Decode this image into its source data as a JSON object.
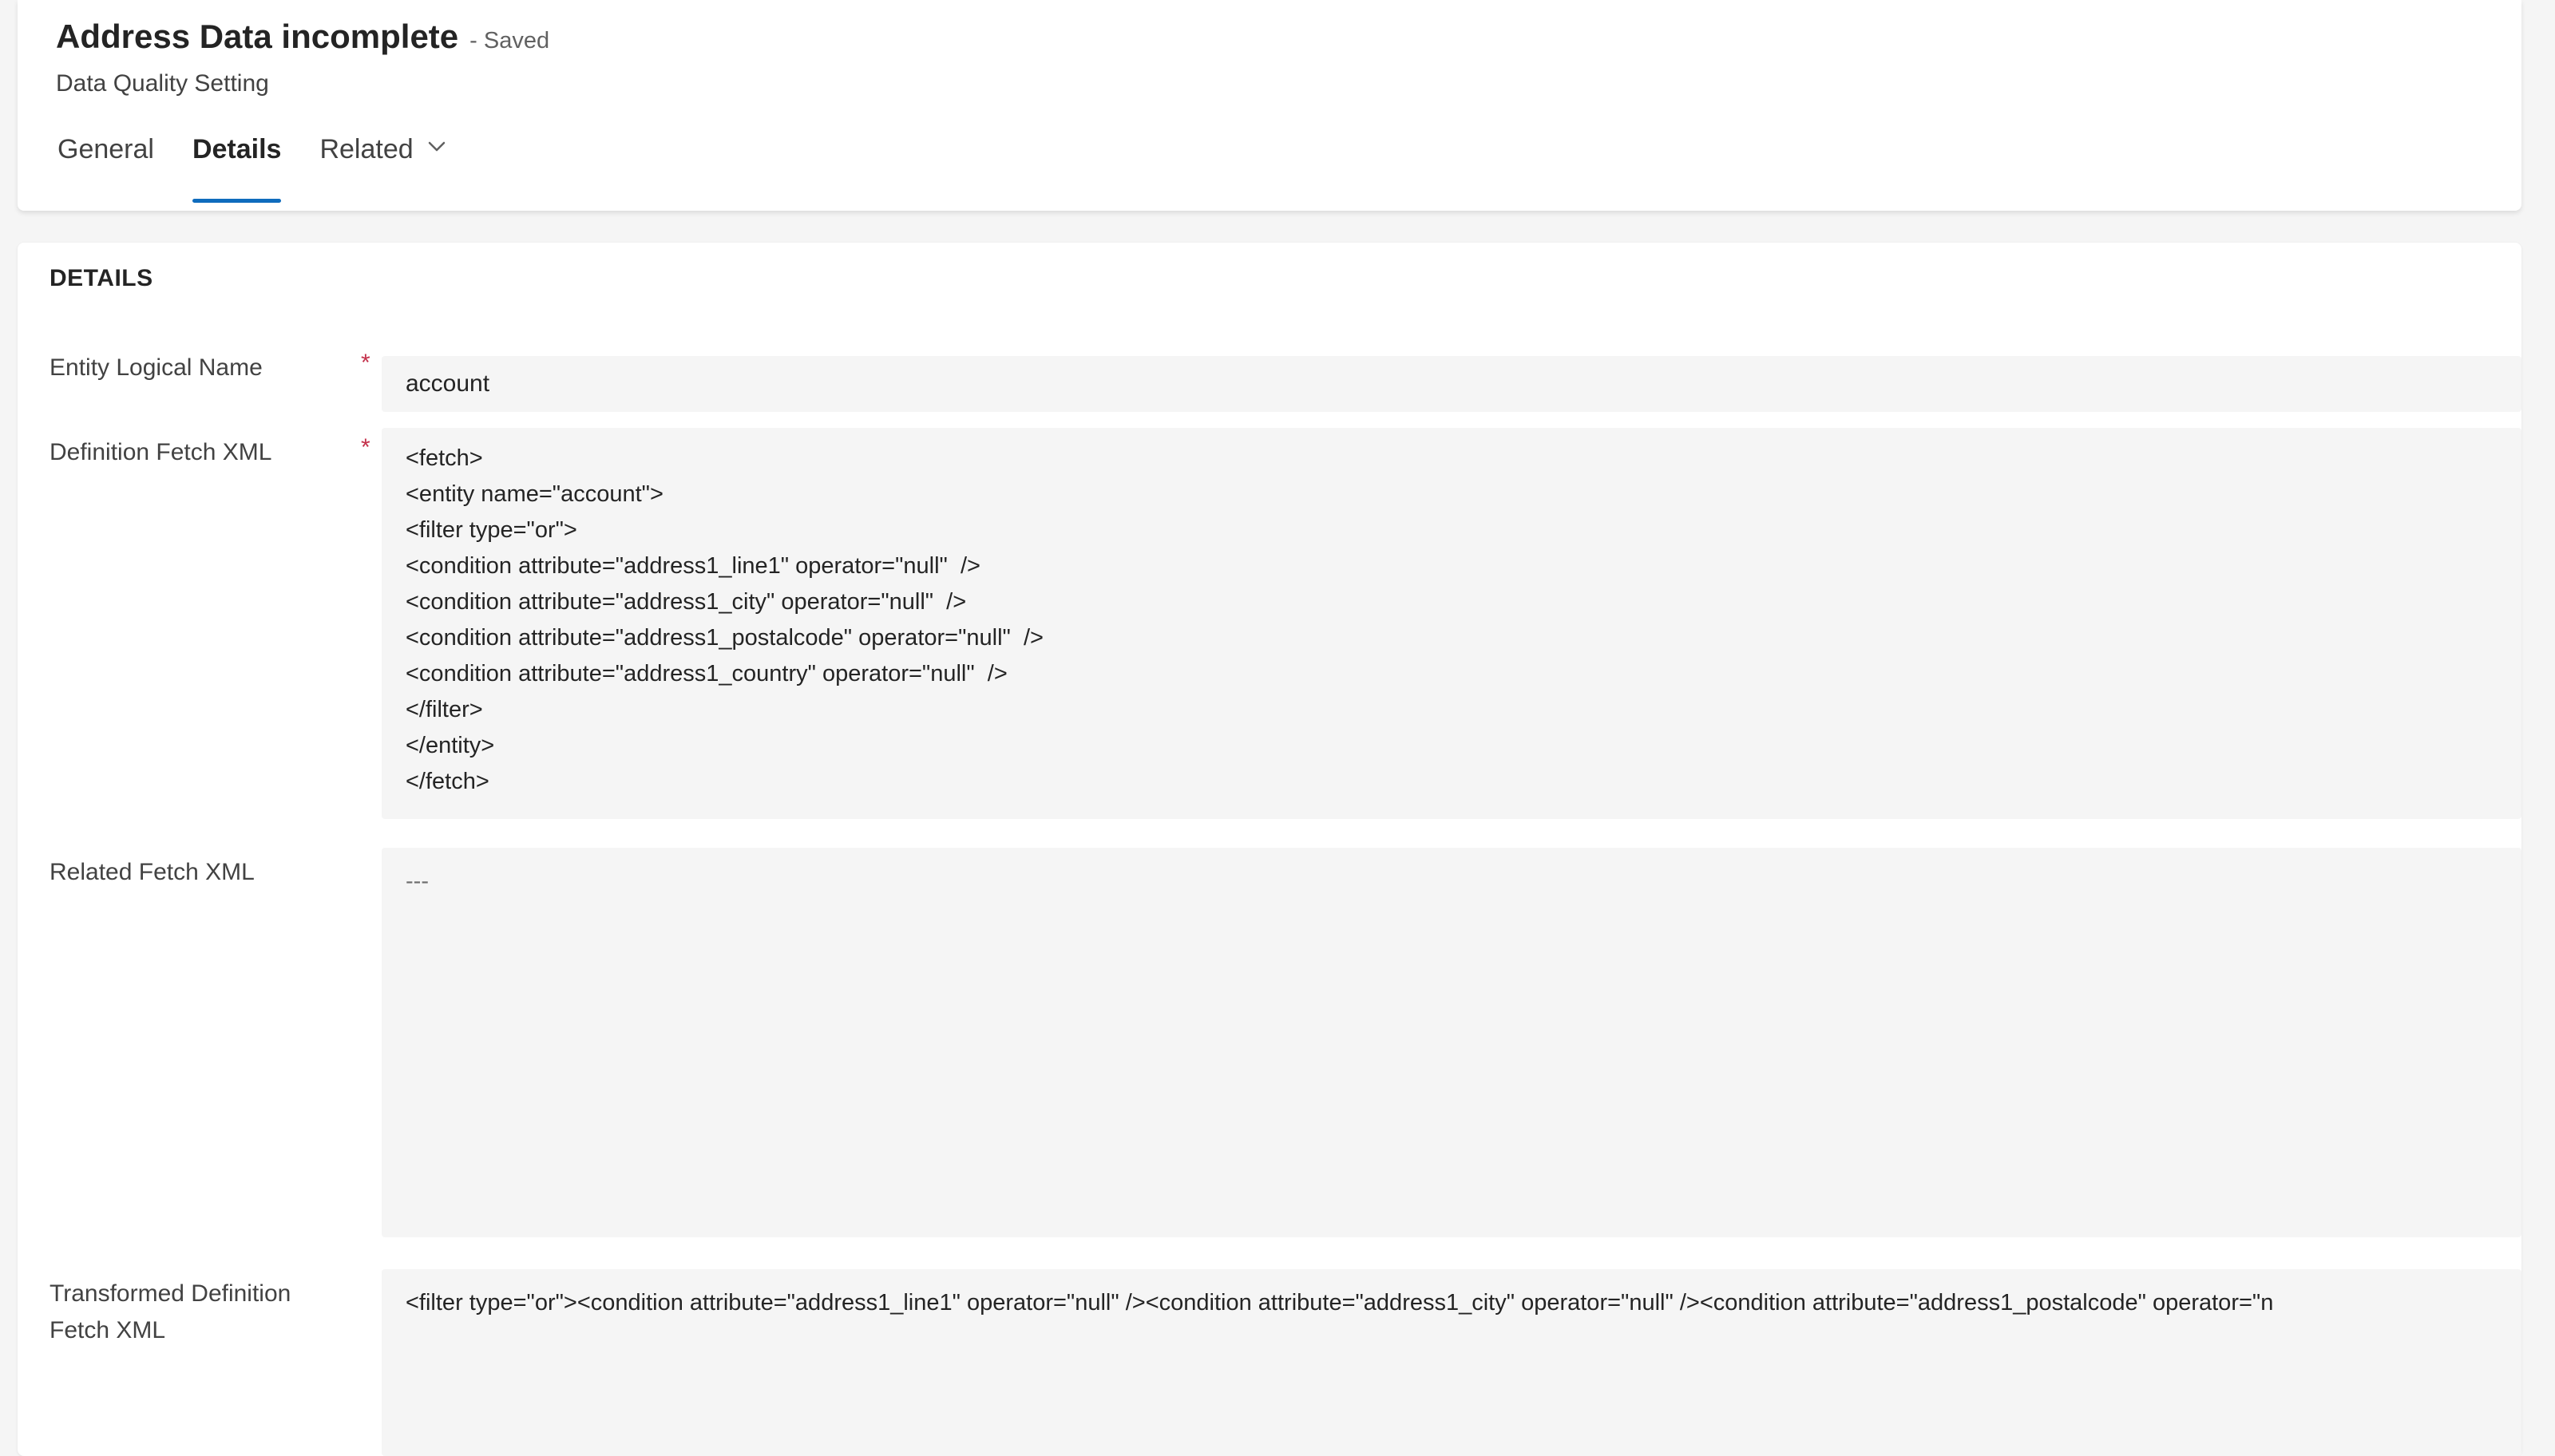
{
  "header": {
    "title": "Address Data incomplete",
    "status": "- Saved",
    "subtitle": "Data Quality Setting",
    "tabs": [
      {
        "label": "General",
        "active": false
      },
      {
        "label": "Details",
        "active": true
      },
      {
        "label": "Related",
        "active": false
      }
    ],
    "accent_color": "#0f6cbd"
  },
  "details": {
    "section_title": "DETAILS",
    "required_marker": "*",
    "entity_logical_name": {
      "label": "Entity Logical Name",
      "value": "account"
    },
    "definition_fetch_xml": {
      "label": "Definition Fetch XML",
      "lines": [
        "<fetch>",
        "<entity name=\"account\">",
        "<filter type=\"or\">",
        "<condition attribute=\"address1_line1\" operator=\"null\"  />",
        "<condition attribute=\"address1_city\" operator=\"null\"  />",
        "<condition attribute=\"address1_postalcode\" operator=\"null\"  />",
        "<condition attribute=\"address1_country\" operator=\"null\"  />",
        "</filter>",
        "</entity>",
        "</fetch>"
      ]
    },
    "related_fetch_xml": {
      "label": "Related Fetch XML",
      "value": "---"
    },
    "transformed_definition_fetch_xml": {
      "label_line1": "Transformed Definition",
      "label_line2": "Fetch XML",
      "value": "<filter type=\"or\"><condition attribute=\"address1_line1\" operator=\"null\" /><condition attribute=\"address1_city\" operator=\"null\" /><condition attribute=\"address1_postalcode\" operator=\"n"
    }
  }
}
